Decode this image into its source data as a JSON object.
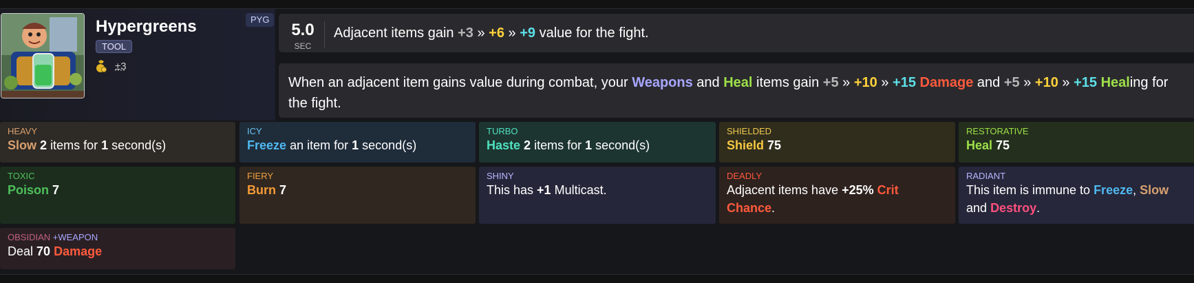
{
  "item": {
    "name": "Hypergreens",
    "type_tag": "TOOL",
    "pack_tag": "PYG",
    "value": "±3",
    "icons": {
      "portrait": "hypergreens-portrait",
      "value": "coin-bag-icon"
    }
  },
  "cooldown": {
    "value": "5.0",
    "unit": "SEC"
  },
  "effect": {
    "prefix": "Adjacent items gain",
    "v1": "+3",
    "sep1": "»",
    "v2": "+6",
    "sep2": "»",
    "v3": "+9",
    "suffix": "value for the fight."
  },
  "ability": {
    "t1": "When an adjacent item gains value during combat, your",
    "weapons": "Weapons",
    "and1": "and",
    "heal": "Heal",
    "t2": "items gain",
    "d1": "+5",
    "s1": "»",
    "d2": "+10",
    "s2": "»",
    "d3": "+15",
    "damage": "Damage",
    "and2": "and",
    "h1": "+5",
    "s3": "»",
    "h2": "+10",
    "s4": "»",
    "h3": "+15",
    "heal_word": "Heal",
    "t3": "ing for the fight."
  },
  "enchantments": {
    "heavy": {
      "title": "HEAVY",
      "kw": "Slow",
      "n1": "2",
      "mid": "items for",
      "n2": "1",
      "end": "second(s)"
    },
    "icy": {
      "title": "ICY",
      "kw": "Freeze",
      "mid": "an item for",
      "n2": "1",
      "end": "second(s)"
    },
    "turbo": {
      "title": "TURBO",
      "kw": "Haste",
      "n1": "2",
      "mid": "items for",
      "n2": "1",
      "end": "second(s)"
    },
    "shielded": {
      "title": "SHIELDED",
      "kw": "Shield",
      "n1": "75"
    },
    "restorative": {
      "title": "RESTORATIVE",
      "kw": "Heal",
      "n1": "75"
    },
    "toxic": {
      "title": "TOXIC",
      "kw": "Poison",
      "n1": "7"
    },
    "fiery": {
      "title": "FIERY",
      "kw": "Burn",
      "n1": "7"
    },
    "shiny": {
      "title": "SHINY",
      "t1": "This has",
      "n1": "+1",
      "t2": "Multicast."
    },
    "deadly": {
      "title": "DEADLY",
      "t1": "Adjacent items have",
      "n1": "+25%",
      "kw": "Crit Chance",
      "end": "."
    },
    "radiant": {
      "title": "RADIANT",
      "t1": "This item is immune to",
      "k1": "Freeze",
      "c1": ",",
      "k2": "Slow",
      "and": "and",
      "k3": "Destroy",
      "end": "."
    },
    "obsidian": {
      "title": "OBSIDIAN",
      "sub": "+WEAPON",
      "t1": "Deal",
      "n1": "70",
      "kw": "Damage"
    }
  }
}
